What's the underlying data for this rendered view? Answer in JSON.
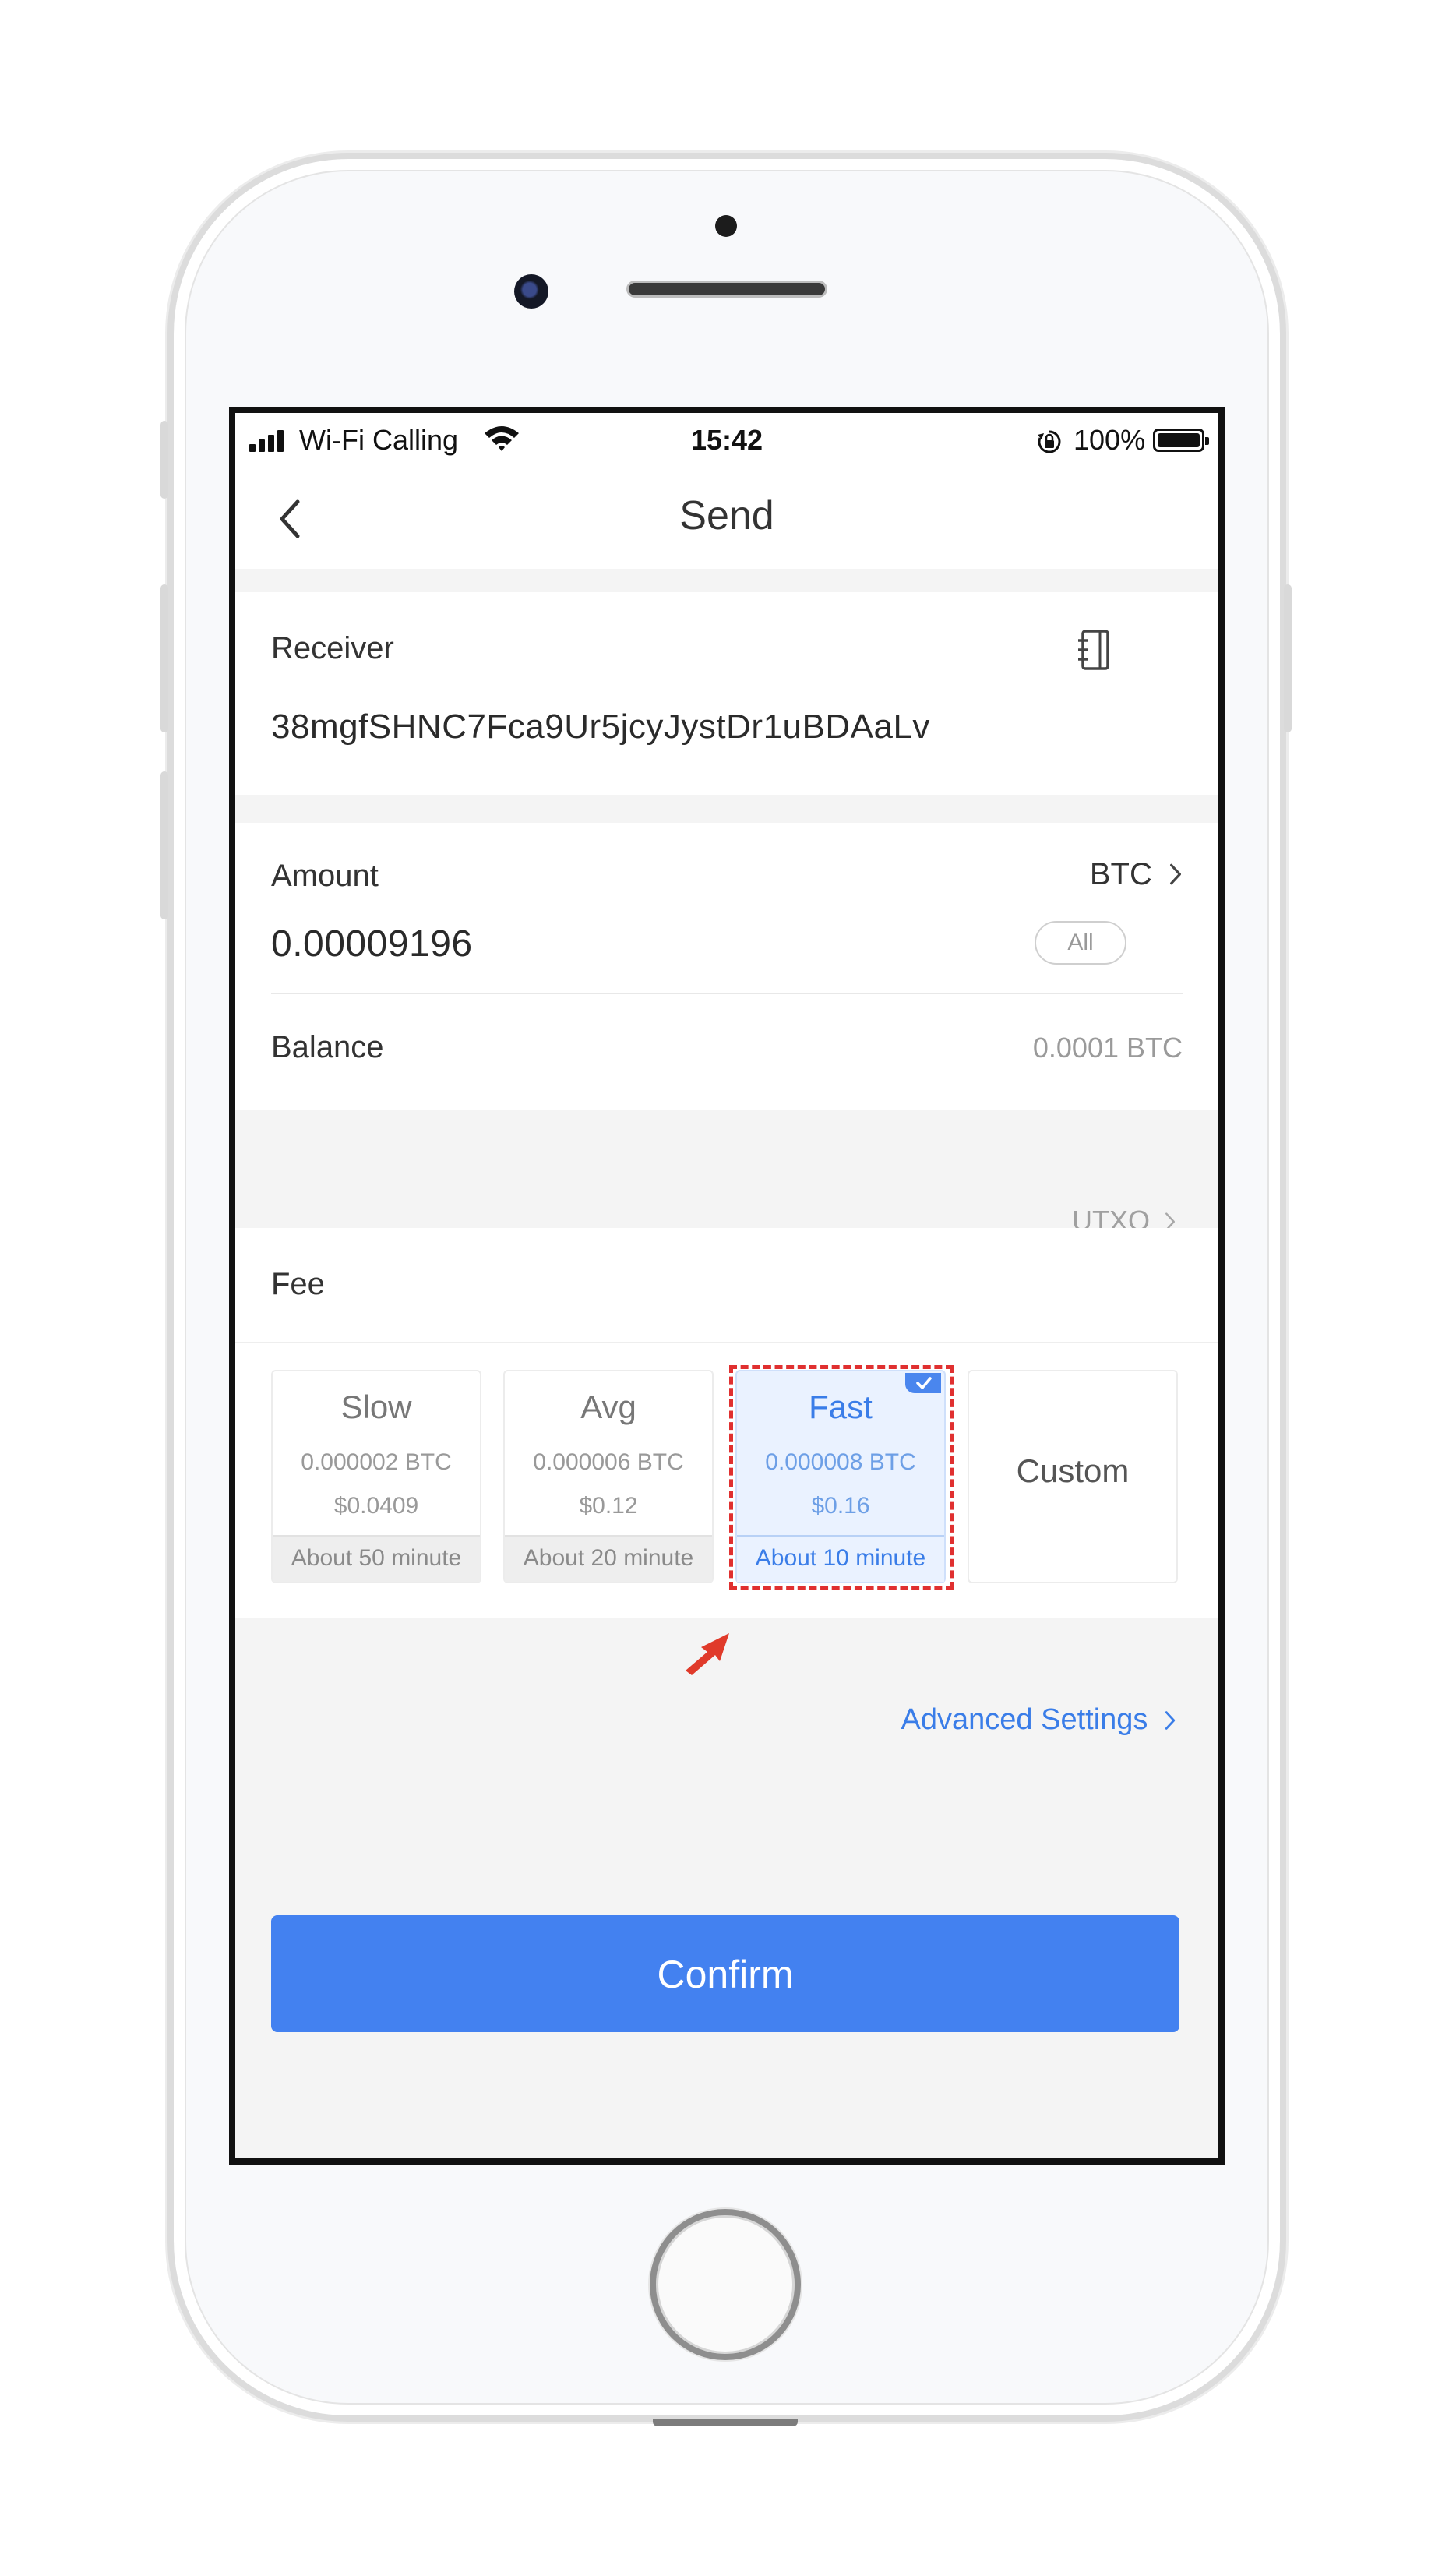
{
  "status_bar": {
    "carrier": "Wi-Fi Calling",
    "time": "15:42",
    "battery": "100%"
  },
  "nav": {
    "title": "Send"
  },
  "receiver": {
    "label": "Receiver",
    "address": "38mgfSHNC7Fca9Ur5jcyJystDr1uBDAaLv",
    "icon": "address-book-icon"
  },
  "amount": {
    "label": "Amount",
    "currency": "BTC",
    "value": "0.00009196",
    "all_label": "All"
  },
  "balance": {
    "label": "Balance",
    "value": "0.0001 BTC"
  },
  "utxo": {
    "label": "UTXO"
  },
  "fee": {
    "label": "Fee",
    "options": [
      {
        "name": "Slow",
        "btc": "0.000002 BTC",
        "usd": "$0.0409",
        "eta": "About 50 minute"
      },
      {
        "name": "Avg",
        "btc": "0.000006 BTC",
        "usd": "$0.12",
        "eta": "About 20 minute"
      },
      {
        "name": "Fast",
        "btc": "0.000008 BTC",
        "usd": "$0.16",
        "eta": "About 10 minute",
        "selected": true
      },
      {
        "name": "Custom"
      }
    ]
  },
  "advanced_settings": "Advanced Settings",
  "confirm_label": "Confirm",
  "colors": {
    "accent": "#4381f0",
    "highlight": "#e03030"
  }
}
